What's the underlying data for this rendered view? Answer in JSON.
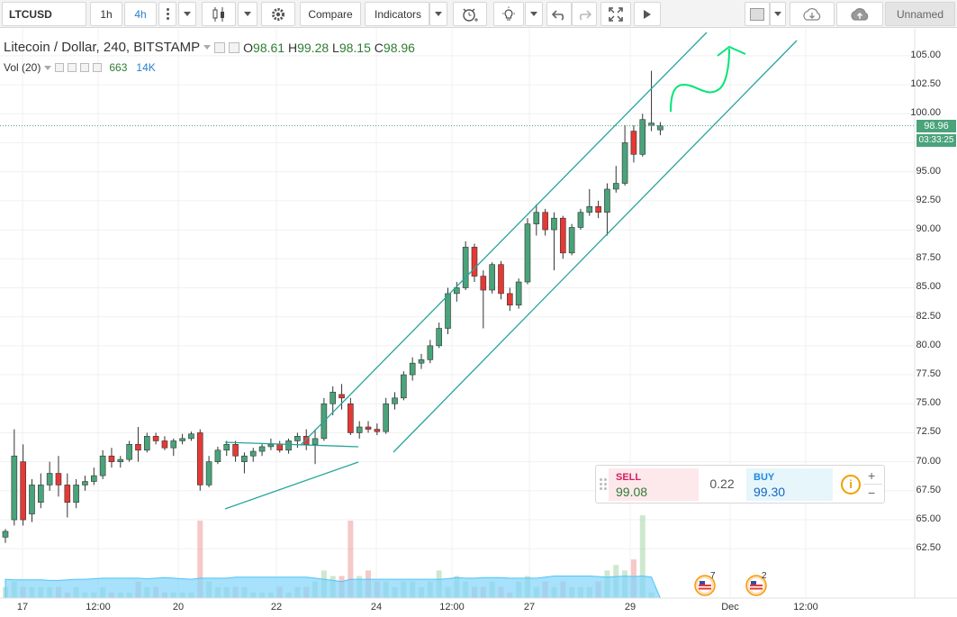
{
  "toolbar": {
    "symbol": "LTCUSD",
    "interval_1h": "1h",
    "interval_4h": "4h",
    "compare": "Compare",
    "indicators": "Indicators",
    "layout_name": "Unnamed",
    "icons": [
      "candles-icon",
      "settings-icon",
      "alert-icon",
      "idea-icon",
      "undo-icon",
      "redo-icon",
      "fullscreen-icon",
      "replay-icon",
      "rectangle-icon",
      "cloud-save-icon",
      "cloud-load-icon"
    ]
  },
  "legend": {
    "title": "Litecoin / Dollar, 240, BITSTAMP",
    "open_label": "O",
    "open": "98.61",
    "high_label": "H",
    "high": "99.28",
    "low_label": "L",
    "low": "98.15",
    "close_label": "C",
    "close": "98.96",
    "vol_label": "Vol (20)",
    "vol_value": "663",
    "vol_ma": "14K"
  },
  "price_scale": [
    "105.00",
    "102.50",
    "100.00",
    "97.50",
    "95.00",
    "92.50",
    "90.00",
    "87.50",
    "85.00",
    "82.50",
    "80.00",
    "77.50",
    "75.00",
    "72.50",
    "70.00",
    "67.50",
    "65.00",
    "62.50"
  ],
  "last_price": "98.96",
  "countdown": "03:33:25",
  "time_scale": [
    "17",
    "12:00",
    "20",
    "22",
    "24",
    "12:00",
    "27",
    "29",
    "Dec",
    "12:00"
  ],
  "trade_panel": {
    "sell_label": "SELL",
    "sell_price": "99.08",
    "spread": "0.22",
    "buy_label": "BUY",
    "buy_price": "99.30",
    "info": "i",
    "plus": "+",
    "minus": "−"
  },
  "events": [
    {
      "count": "7"
    },
    {
      "count": "2"
    }
  ],
  "colors": {
    "up": "#4aa37a",
    "down": "#e53935",
    "channel": "#26a69a",
    "arrow": "#00e676",
    "volume_area": "#81d4fa"
  },
  "chart_data": {
    "type": "candlestick",
    "ylim": [
      60.5,
      106
    ],
    "candles": [
      {
        "o": 63.5,
        "h": 64.2,
        "l": 63.0,
        "c": 64.0
      },
      {
        "o": 65.0,
        "h": 72.8,
        "l": 64.5,
        "c": 70.5
      },
      {
        "o": 70.0,
        "h": 71.5,
        "l": 64.5,
        "c": 65.0
      },
      {
        "o": 65.5,
        "h": 68.5,
        "l": 64.8,
        "c": 68.0
      },
      {
        "o": 66.5,
        "h": 69.0,
        "l": 66.0,
        "c": 68.0
      },
      {
        "o": 68.0,
        "h": 70.0,
        "l": 67.5,
        "c": 69.0
      },
      {
        "o": 69.0,
        "h": 70.5,
        "l": 67.0,
        "c": 68.0
      },
      {
        "o": 68.0,
        "h": 69.0,
        "l": 65.2,
        "c": 66.5
      },
      {
        "o": 66.5,
        "h": 68.5,
        "l": 66.0,
        "c": 68.0
      },
      {
        "o": 68.0,
        "h": 68.8,
        "l": 67.5,
        "c": 68.3
      },
      {
        "o": 68.3,
        "h": 69.5,
        "l": 68.0,
        "c": 68.8
      },
      {
        "o": 68.8,
        "h": 71.0,
        "l": 68.5,
        "c": 70.5
      },
      {
        "o": 70.5,
        "h": 71.2,
        "l": 69.5,
        "c": 70.0
      },
      {
        "o": 70.0,
        "h": 70.5,
        "l": 69.5,
        "c": 70.2
      },
      {
        "o": 70.2,
        "h": 71.8,
        "l": 70.0,
        "c": 71.5
      },
      {
        "o": 71.5,
        "h": 73.0,
        "l": 70.0,
        "c": 71.0
      },
      {
        "o": 71.0,
        "h": 72.5,
        "l": 70.8,
        "c": 72.2
      },
      {
        "o": 72.2,
        "h": 72.5,
        "l": 71.5,
        "c": 71.8
      },
      {
        "o": 71.8,
        "h": 72.2,
        "l": 71.0,
        "c": 71.2
      },
      {
        "o": 71.2,
        "h": 72.0,
        "l": 70.5,
        "c": 71.8
      },
      {
        "o": 71.8,
        "h": 72.4,
        "l": 71.5,
        "c": 72.0
      },
      {
        "o": 72.0,
        "h": 72.6,
        "l": 71.8,
        "c": 72.4
      },
      {
        "o": 72.5,
        "h": 72.8,
        "l": 67.5,
        "c": 68.0
      },
      {
        "o": 68.0,
        "h": 70.5,
        "l": 67.8,
        "c": 70.0
      },
      {
        "o": 70.0,
        "h": 71.3,
        "l": 69.8,
        "c": 71.0
      },
      {
        "o": 71.0,
        "h": 71.8,
        "l": 70.5,
        "c": 71.5
      },
      {
        "o": 71.5,
        "h": 71.8,
        "l": 70.0,
        "c": 70.5
      },
      {
        "o": 70.0,
        "h": 70.8,
        "l": 69.0,
        "c": 70.5
      },
      {
        "o": 70.5,
        "h": 71.2,
        "l": 70.0,
        "c": 70.9
      },
      {
        "o": 70.9,
        "h": 71.6,
        "l": 70.5,
        "c": 71.3
      },
      {
        "o": 71.3,
        "h": 72.0,
        "l": 71.0,
        "c": 71.5
      },
      {
        "o": 71.5,
        "h": 71.8,
        "l": 70.8,
        "c": 71.0
      },
      {
        "o": 71.0,
        "h": 72.0,
        "l": 70.7,
        "c": 71.8
      },
      {
        "o": 71.8,
        "h": 72.5,
        "l": 71.2,
        "c": 72.2
      },
      {
        "o": 72.2,
        "h": 72.8,
        "l": 71.0,
        "c": 71.5
      },
      {
        "o": 71.5,
        "h": 72.8,
        "l": 69.8,
        "c": 72.0
      },
      {
        "o": 72.0,
        "h": 75.5,
        "l": 71.8,
        "c": 75.0
      },
      {
        "o": 75.0,
        "h": 76.5,
        "l": 74.0,
        "c": 76.0
      },
      {
        "o": 75.8,
        "h": 76.7,
        "l": 74.5,
        "c": 75.5
      },
      {
        "o": 75.0,
        "h": 75.5,
        "l": 72.3,
        "c": 72.5
      },
      {
        "o": 72.5,
        "h": 73.5,
        "l": 72.0,
        "c": 73.0
      },
      {
        "o": 73.0,
        "h": 73.5,
        "l": 72.5,
        "c": 72.8
      },
      {
        "o": 72.8,
        "h": 73.3,
        "l": 72.3,
        "c": 72.6
      },
      {
        "o": 72.6,
        "h": 75.5,
        "l": 72.4,
        "c": 75.0
      },
      {
        "o": 75.0,
        "h": 76.0,
        "l": 74.5,
        "c": 75.5
      },
      {
        "o": 75.5,
        "h": 77.8,
        "l": 75.3,
        "c": 77.5
      },
      {
        "o": 77.5,
        "h": 79.0,
        "l": 77.0,
        "c": 78.5
      },
      {
        "o": 78.5,
        "h": 79.3,
        "l": 78.0,
        "c": 78.8
      },
      {
        "o": 78.8,
        "h": 80.5,
        "l": 78.5,
        "c": 80.0
      },
      {
        "o": 80.0,
        "h": 82.0,
        "l": 79.8,
        "c": 81.5
      },
      {
        "o": 81.5,
        "h": 85.0,
        "l": 81.0,
        "c": 84.5
      },
      {
        "o": 84.5,
        "h": 85.5,
        "l": 83.8,
        "c": 85.0
      },
      {
        "o": 85.0,
        "h": 89.0,
        "l": 84.8,
        "c": 88.5
      },
      {
        "o": 88.5,
        "h": 88.8,
        "l": 85.5,
        "c": 86.0
      },
      {
        "o": 86.0,
        "h": 86.5,
        "l": 81.5,
        "c": 84.8
      },
      {
        "o": 84.8,
        "h": 87.2,
        "l": 84.5,
        "c": 87.0
      },
      {
        "o": 87.0,
        "h": 87.3,
        "l": 84.0,
        "c": 84.5
      },
      {
        "o": 84.5,
        "h": 85.0,
        "l": 83.0,
        "c": 83.5
      },
      {
        "o": 83.5,
        "h": 85.8,
        "l": 83.2,
        "c": 85.5
      },
      {
        "o": 85.5,
        "h": 91.0,
        "l": 85.3,
        "c": 90.5
      },
      {
        "o": 90.5,
        "h": 92.2,
        "l": 89.5,
        "c": 91.5
      },
      {
        "o": 91.5,
        "h": 91.8,
        "l": 89.5,
        "c": 90.0
      },
      {
        "o": 90.0,
        "h": 91.5,
        "l": 86.5,
        "c": 91.0
      },
      {
        "o": 91.0,
        "h": 91.2,
        "l": 87.5,
        "c": 88.0
      },
      {
        "o": 88.0,
        "h": 90.5,
        "l": 87.8,
        "c": 90.2
      },
      {
        "o": 90.2,
        "h": 91.8,
        "l": 90.0,
        "c": 91.5
      },
      {
        "o": 91.5,
        "h": 93.5,
        "l": 91.2,
        "c": 92.0
      },
      {
        "o": 92.0,
        "h": 92.5,
        "l": 91.0,
        "c": 91.5
      },
      {
        "o": 91.5,
        "h": 94.0,
        "l": 89.5,
        "c": 93.5
      },
      {
        "o": 93.5,
        "h": 95.5,
        "l": 93.2,
        "c": 94.0
      },
      {
        "o": 94.0,
        "h": 99.0,
        "l": 93.8,
        "c": 97.5
      },
      {
        "o": 98.5,
        "h": 99.0,
        "l": 95.8,
        "c": 96.5
      },
      {
        "o": 96.5,
        "h": 100.0,
        "l": 96.3,
        "c": 99.5
      },
      {
        "o": 99.0,
        "h": 103.7,
        "l": 98.5,
        "c": 99.2
      },
      {
        "o": 98.61,
        "h": 99.28,
        "l": 98.15,
        "c": 98.96
      }
    ],
    "volume": [
      2,
      3,
      2,
      2,
      2,
      2,
      2,
      1,
      2,
      1,
      1,
      2,
      1,
      1,
      1,
      3,
      2,
      2,
      1,
      1,
      1,
      1,
      14,
      3,
      2,
      2,
      2,
      2,
      1,
      1,
      1,
      2,
      1,
      2,
      2,
      3,
      5,
      4,
      4,
      14,
      4,
      5,
      3,
      3,
      2,
      3,
      3,
      2,
      3,
      5,
      2,
      4,
      3,
      2,
      2,
      3,
      2,
      1,
      3,
      4,
      2,
      3,
      2,
      3,
      2,
      2,
      2,
      3,
      5,
      6,
      5,
      7,
      15,
      1
    ],
    "volume_max": 15,
    "ma_volume": [
      3.4,
      3.3,
      3.3,
      3.3,
      3.3,
      3.2,
      3.2,
      3.3,
      3.4,
      3.4,
      3.5,
      3.6,
      3.6,
      3.6,
      3.6,
      3.6,
      3.5,
      3.6,
      3.7,
      3.6,
      3.5,
      3.4,
      3.6,
      3.6,
      3.6,
      3.6,
      3.8,
      3.8,
      3.8,
      3.8,
      3.8,
      3.8,
      3.8,
      3.8,
      3.8,
      3.6,
      3.4,
      3.2,
      3.0,
      3.4,
      3.4,
      3.4,
      3.4,
      3.4,
      3.4,
      3.4,
      3.4,
      3.4,
      3.4,
      3.4,
      3.5,
      3.7,
      3.6,
      3.6,
      3.7,
      3.7,
      3.7,
      3.6,
      3.6,
      3.6,
      3.6,
      3.8,
      4.0,
      4.0,
      4.0,
      4.0,
      4.0,
      3.9,
      3.8,
      3.9,
      4.0,
      3.9,
      4.0,
      3.8
    ]
  }
}
